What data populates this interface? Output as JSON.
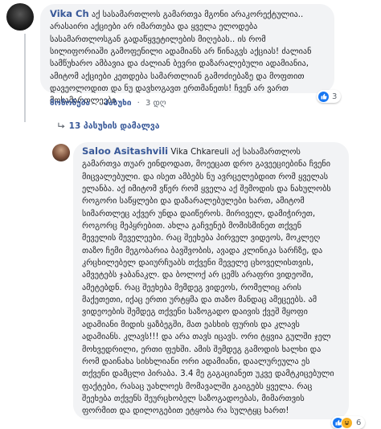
{
  "comment1": {
    "author": "Vika Ch",
    "text": "აქ სასამართლოს გამართვა მგონი არაკორექტულია.. არასაირი აქციები არ იმართება და ყველა ელოდება სასამართლოსგან გადაწყვეტილების მიღებას.. ის რომ სილიფორიაში გამოფენილი ადამიანს არ წინაგვს აქციას! ძალიან სამწუხარო ამბავია და ძალიან ბევრი დაზარალებული ადამიანია, ამიტომ აქციები კეთდება სამართლიან გამოძიებაზე და მოფთით დავეოლოდით და ნუ დავხოგავთ ერთმანეთს! ჩვენ არ ვართ მოსამართლეები",
    "actions": [
      "მოწონება",
      "·",
      "პასუხი",
      "·",
      "3 დღ"
    ],
    "reactions_count": "3"
  },
  "replies_link": "13 პასუხის დამალვა",
  "comment2": {
    "author": "Saloo Asitashvili",
    "mention": "Vika Chkareuli",
    "text": "აქ სასამართლოს გამართვა თუარ ეინდოდათ, მოეეცათ დრო გავეეციებინა ჩვენი მიცვალებული. და ისეთ ამბებს ნუ ავრცელებდით რომ ყველას ელანბა. აქ იმიტომ ვწერ რომ ყველა აქ შემოდის და ნახულობს როგორი საწყლები და დაზარალებულები ხართ, ამიტომ სიმართლეც აქვერ უნდა დაიწეროს. მირიველ, დამიჭირეთ, როგორც მეპყრებით. ახლა გაჩვენებ მომისმინეთ თქვენ მეველის მეველეები. რაც შეეხება პირველ ვიდეოს, მოკლეღ თაზო ჩემი მეგობარია ბავშვობის, ავადა კლინიკა სარჩზე, და კრცხილებელ დაიურჩუაბს თქვენი მეველე ცხოველისთვის, ამვეტებს ჯაბანაკლ. და ბოლოქ არ ცემს არაფრი ვიდეოში, ამეტებდნ. რაც შეეხება მემდეგ ვიდეოს, რომელიც არის მაქეთეთი, იქაც ერთი ურტყმა და თაზო მანდაც ამეცეებს. ამ ვიდეოების შემდეგ თქვენი საზოგადო დაივის ქვეშ მყოფი ადამიანი მიდის ყაზბეგში, მათ ეასხის ფურის და კლავს ადამიანს. კლავს!!! და არა თავს იცავს. ორი ტყვია გულში ჯელ მოხვედრილი, ერთი ფეხში. ამის შემდეგ გამოდის ხალხი და რომ დაინახა სისხლიანი ორი ადამიანი, დაალურეულა ეს თქვენი დამცლი პირაბა. 3.4 მე გაგაციანეთ უკვე დამტკიცებული ფაქტები, რასაც უახლოეს მომავალში გაიგებს ყველა. რაც შეეხება თქვენს შეურცხობელ საზოგადოებას, მიმართვის ფორმით და დილოგებით ეტყობა რა სულტყც ხართ!",
    "reactions_count": "6"
  },
  "colors": {
    "link": "#385898",
    "bubble": "#f2f3f5",
    "like": "#1877f2",
    "haha": "#f7b125",
    "meta": "#606770"
  },
  "icons": [
    "like-icon",
    "haha-icon",
    "reply-arrow-icon"
  ]
}
